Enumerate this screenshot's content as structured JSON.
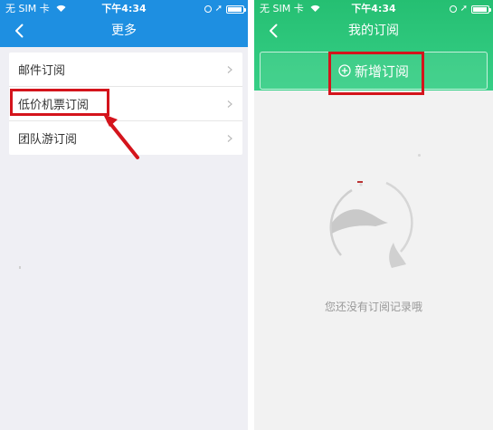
{
  "left_screen": {
    "status": {
      "carrier": "无 SIM 卡",
      "time": "下午4:34"
    },
    "nav": {
      "title": "更多"
    },
    "menu_items": [
      {
        "label": "邮件订阅"
      },
      {
        "label": "低价机票订阅"
      },
      {
        "label": "团队游订阅"
      }
    ]
  },
  "right_screen": {
    "status": {
      "carrier": "无 SIM 卡",
      "time": "下午4:34"
    },
    "nav": {
      "title": "我的订阅"
    },
    "add_button_label": "新增订阅",
    "empty_message": "您还没有订阅记录哦"
  },
  "colors": {
    "left_header": "#1e8fe1",
    "right_header": "#25bf72",
    "highlight": "#d4141c"
  },
  "icons": [
    "back-arrow-icon",
    "chevron-right-icon",
    "plus-circle-icon",
    "wifi-icon",
    "location-icon",
    "battery-icon"
  ]
}
